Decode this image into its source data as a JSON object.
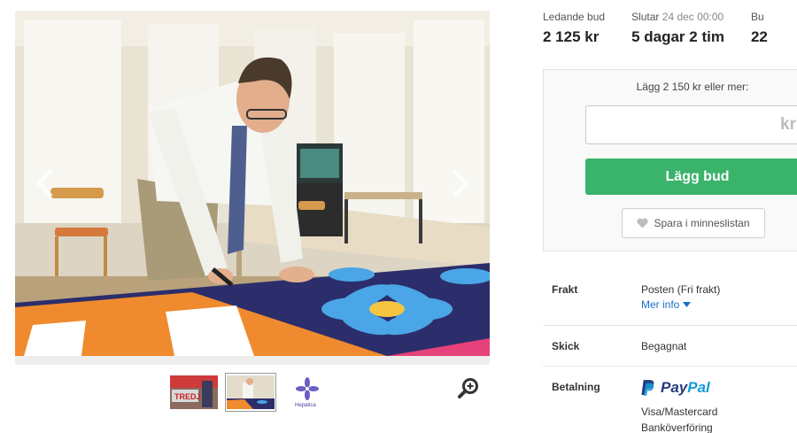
{
  "gallery": {
    "prev_icon": "chevron-left-icon",
    "next_icon": "chevron-right-icon",
    "thumbnails": [
      {
        "name": "thumbnail-banner-photo",
        "text": "TREDJ",
        "active": false
      },
      {
        "name": "thumbnail-signing-photo",
        "active": true
      },
      {
        "name": "thumbnail-hepatica-logo",
        "text": "Hepatica",
        "active": false
      }
    ],
    "zoom_icon": "zoom-in-icon"
  },
  "stats": [
    {
      "label": "Ledande bud",
      "date": "",
      "value": "2 125 kr"
    },
    {
      "label": "Slutar",
      "date": "24 dec 00:00",
      "value": "5 dagar 2 tim"
    },
    {
      "label": "Bu",
      "date": "",
      "value": "22"
    }
  ],
  "bid": {
    "hint": "Lägg 2 150 kr eller mer:",
    "input_placeholder": "kr",
    "input_value": "",
    "submit_label": "Lägg bud",
    "wishlist_label": "Spara i minneslistan",
    "wishlist_icon": "heart-icon"
  },
  "info": {
    "frakt": {
      "label": "Frakt",
      "value": "Posten (Fri frakt)",
      "more": "Mer info"
    },
    "skick": {
      "label": "Skick",
      "value": "Begagnat"
    },
    "betalning": {
      "label": "Betalning",
      "paypal_pay": "Pay",
      "paypal_pal": "Pal",
      "line1": "Visa/Mastercard",
      "line2": "Banköverföring"
    }
  },
  "colors": {
    "accent_green": "#3ab36b",
    "link_blue": "#1a6fc9",
    "paypal_dark": "#253b80",
    "paypal_light": "#179bd7"
  }
}
